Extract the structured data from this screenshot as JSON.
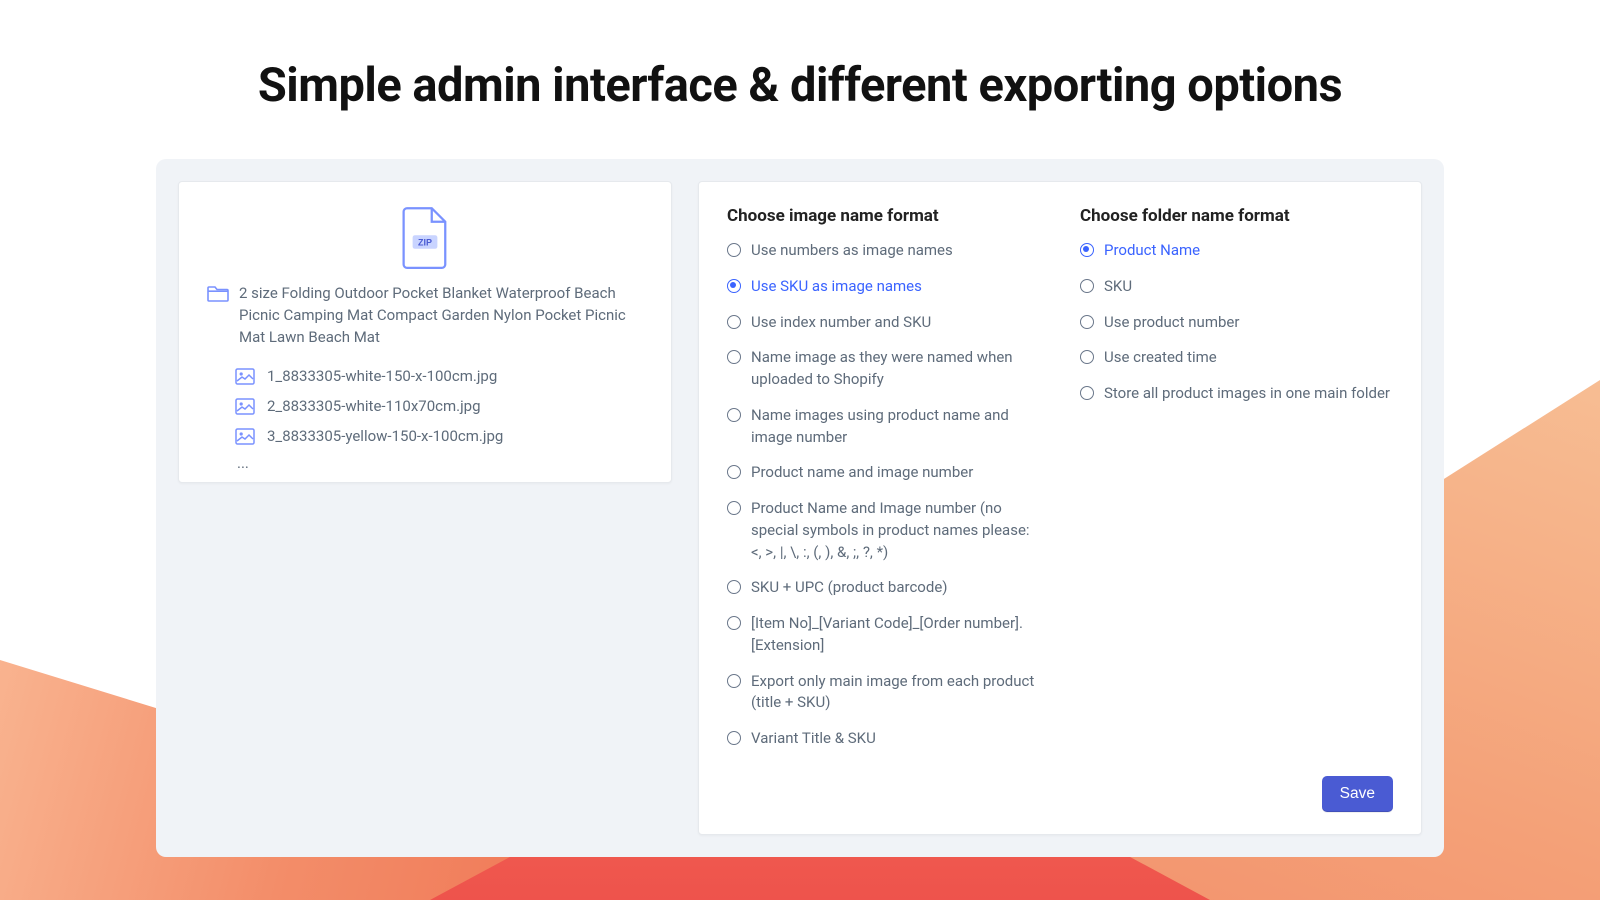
{
  "title": "Simple admin interface & different exporting options",
  "preview": {
    "zip_label": "ZIP",
    "folder_name": "2 size Folding Outdoor Pocket Blanket Waterproof Beach Picnic Camping Mat Compact Garden Nylon Pocket Picnic Mat Lawn Beach Mat",
    "files": [
      "1_8833305-white-150-x-100cm.jpg",
      "2_8833305-white-110x70cm.jpg",
      "3_8833305-yellow-150-x-100cm.jpg"
    ],
    "ellipsis": "..."
  },
  "settings": {
    "image_format": {
      "heading": "Choose image name format",
      "selected": 1,
      "options": [
        "Use numbers as image names",
        "Use SKU as image names",
        "Use index number and SKU",
        "Name image as they were named when uploaded to Shopify",
        "Name images using product name and image number",
        "Product name and image number",
        "Product Name and Image number (no special symbols in product names please: <, >, |, \\, :, (, ), &, ;, ?, *)",
        "SKU + UPC (product barcode)",
        "[Item No]_[Variant Code]_[Order number].[Extension]",
        "Export only main image from each product (title + SKU)",
        "Variant Title & SKU"
      ]
    },
    "folder_format": {
      "heading": "Choose folder name format",
      "selected": 0,
      "options": [
        "Product Name",
        "SKU",
        "Use product number",
        "Use created time",
        "Store all product images in one main folder"
      ]
    },
    "save_label": "Save"
  }
}
